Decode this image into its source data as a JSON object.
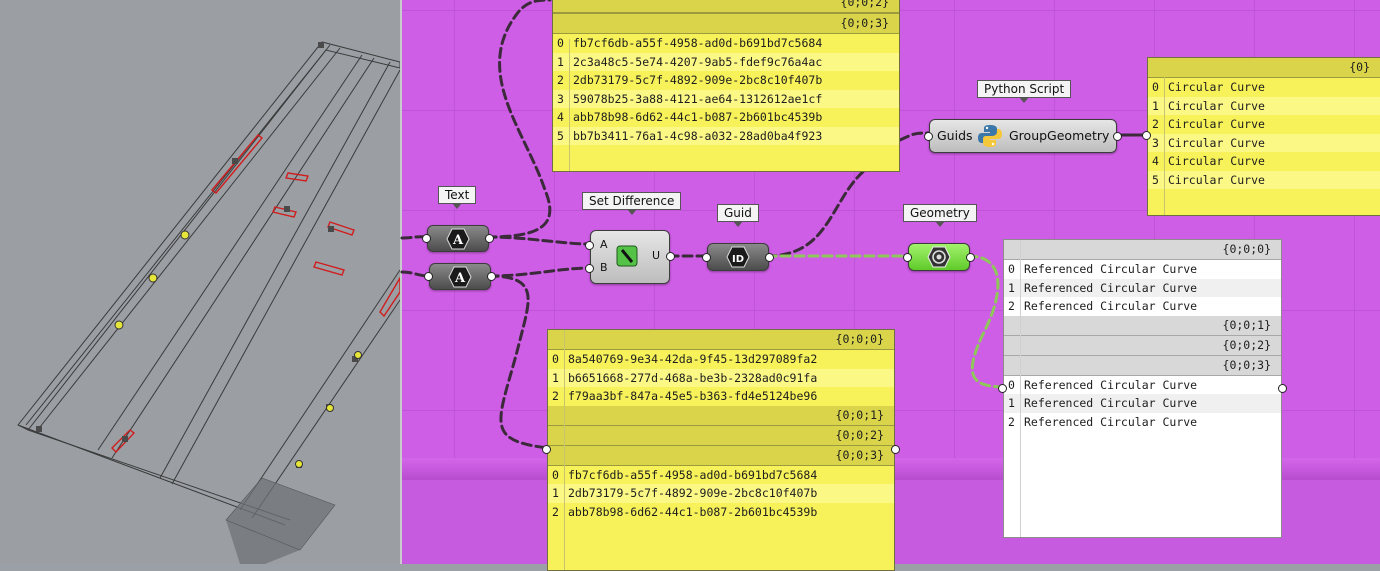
{
  "tags": {
    "text": "Text",
    "set_difference": "Set Difference",
    "guid": "Guid",
    "geometry": "Geometry",
    "python": "Python Script"
  },
  "set_difference": {
    "input_a": "A",
    "input_b": "B",
    "output": "U"
  },
  "python": {
    "input": "Guids",
    "name": "GroupGeometry"
  },
  "panel_top": {
    "path_hidden": "{0;0;2}",
    "path": "{0;0;3}",
    "rows": [
      {
        "i": "0",
        "v": "fb7cf6db-a55f-4958-ad0d-b691bd7c5684"
      },
      {
        "i": "1",
        "v": "2c3a48c5-5e74-4207-9ab5-fdef9c76a4ac"
      },
      {
        "i": "2",
        "v": "2db73179-5c7f-4892-909e-2bc8c10f407b"
      },
      {
        "i": "3",
        "v": "59078b25-3a88-4121-ae64-1312612ae1cf"
      },
      {
        "i": "4",
        "v": "abb78b98-6d62-44c1-b087-2b601bc4539b"
      },
      {
        "i": "5",
        "v": "bb7b3411-76a1-4c98-a032-28ad0ba4f923"
      }
    ]
  },
  "panel_python_out": {
    "path": "{0}",
    "rows": [
      {
        "i": "0",
        "v": "Circular Curve"
      },
      {
        "i": "1",
        "v": "Circular Curve"
      },
      {
        "i": "2",
        "v": "Circular Curve"
      },
      {
        "i": "3",
        "v": "Circular Curve"
      },
      {
        "i": "4",
        "v": "Circular Curve"
      },
      {
        "i": "5",
        "v": "Circular Curve"
      }
    ]
  },
  "panel_bottom": {
    "branches": [
      {
        "path": "{0;0;0}",
        "rows": [
          {
            "i": "0",
            "v": "8a540769-9e34-42da-9f45-13d297089fa2"
          },
          {
            "i": "1",
            "v": "b6651668-277d-468a-be3b-2328ad0c91fa"
          },
          {
            "i": "2",
            "v": "f79aa3bf-847a-45e5-b363-fd4e5124be96"
          }
        ]
      },
      {
        "path": "{0;0;1}",
        "rows": []
      },
      {
        "path": "{0;0;2}",
        "rows": []
      },
      {
        "path": "{0;0;3}",
        "rows": [
          {
            "i": "0",
            "v": "fb7cf6db-a55f-4958-ad0d-b691bd7c5684"
          },
          {
            "i": "1",
            "v": "2db73179-5c7f-4892-909e-2bc8c10f407b"
          },
          {
            "i": "2",
            "v": "abb78b98-6d62-44c1-b087-2b601bc4539b"
          }
        ]
      }
    ]
  },
  "panel_geometry_out": {
    "branches": [
      {
        "path": "{0;0;0}",
        "rows": [
          {
            "i": "0",
            "v": "Referenced Circular Curve"
          },
          {
            "i": "1",
            "v": "Referenced Circular Curve"
          },
          {
            "i": "2",
            "v": "Referenced Circular Curve"
          }
        ]
      },
      {
        "path": "{0;0;1}",
        "rows": []
      },
      {
        "path": "{0;0;2}",
        "rows": []
      },
      {
        "path": "{0;0;3}",
        "rows": [
          {
            "i": "0",
            "v": "Referenced Circular Curve"
          },
          {
            "i": "1",
            "v": "Referenced Circular Curve"
          },
          {
            "i": "2",
            "v": "Referenced Circular Curve"
          }
        ]
      }
    ]
  },
  "colors": {
    "canvas": "#cf5ee6",
    "panel_yellow": "#f7f25a",
    "wire": "#3a2a3a",
    "wire_geometry": "#8fc85a"
  }
}
